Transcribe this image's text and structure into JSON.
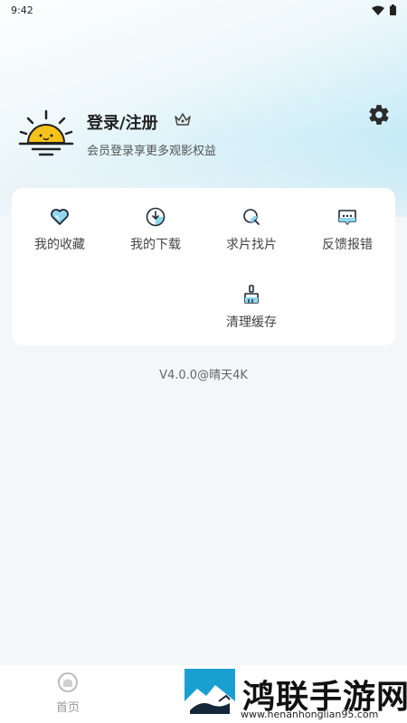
{
  "status_bar": {
    "time": "9:42"
  },
  "profile": {
    "title": "登录/注册",
    "subtitle": "会员登录享更多观影权益"
  },
  "menu": {
    "items": [
      {
        "label": "我的收藏",
        "icon": "heart-icon"
      },
      {
        "label": "我的下载",
        "icon": "download-icon"
      },
      {
        "label": "求片找片",
        "icon": "search-icon"
      },
      {
        "label": "反馈报错",
        "icon": "feedback-icon"
      },
      {
        "label": "清理缓存",
        "icon": "broom-icon"
      }
    ]
  },
  "version": "V4.0.0@晴天4K",
  "bottom_nav": {
    "home_label": "首页"
  },
  "watermark": {
    "title": "鸿联手游网",
    "url": "www.henanhonglian95.com"
  },
  "colors": {
    "accent": "#1a9fd1",
    "sun": "#f6c21a",
    "background": "#f5f6f7"
  }
}
